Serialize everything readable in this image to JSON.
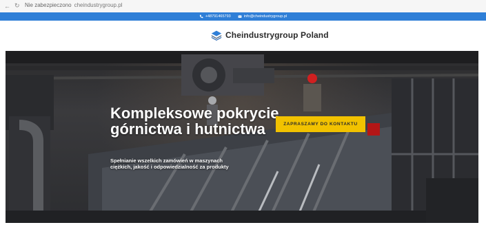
{
  "browser": {
    "back_icon": "arrow-left-icon",
    "reload_icon": "reload-icon",
    "site_label": "Nie zabezpieczono",
    "url": "cheindustrygroup.pl"
  },
  "topbar": {
    "phone": "+48791465793",
    "email": "info@cheindustrygroup.pl",
    "phone_icon": "phone-icon",
    "email_icon": "mail-icon",
    "bg_color": "#2f7fd7"
  },
  "header": {
    "logo_text": "Cheindustrygroup Poland",
    "logo_icon": "stacked-layers-logo-icon"
  },
  "hero": {
    "title": "Kompleksowe pokrycie górnictwa i hutnictwa",
    "subtitle": "Spełnianie wszelkich zamówień w maszynach ciężkich, jakość i odpowiedzialność za produkty",
    "cta_label": "ZAPRASZAMY DO KONTAKTU",
    "cta_color": "#f2c200"
  }
}
